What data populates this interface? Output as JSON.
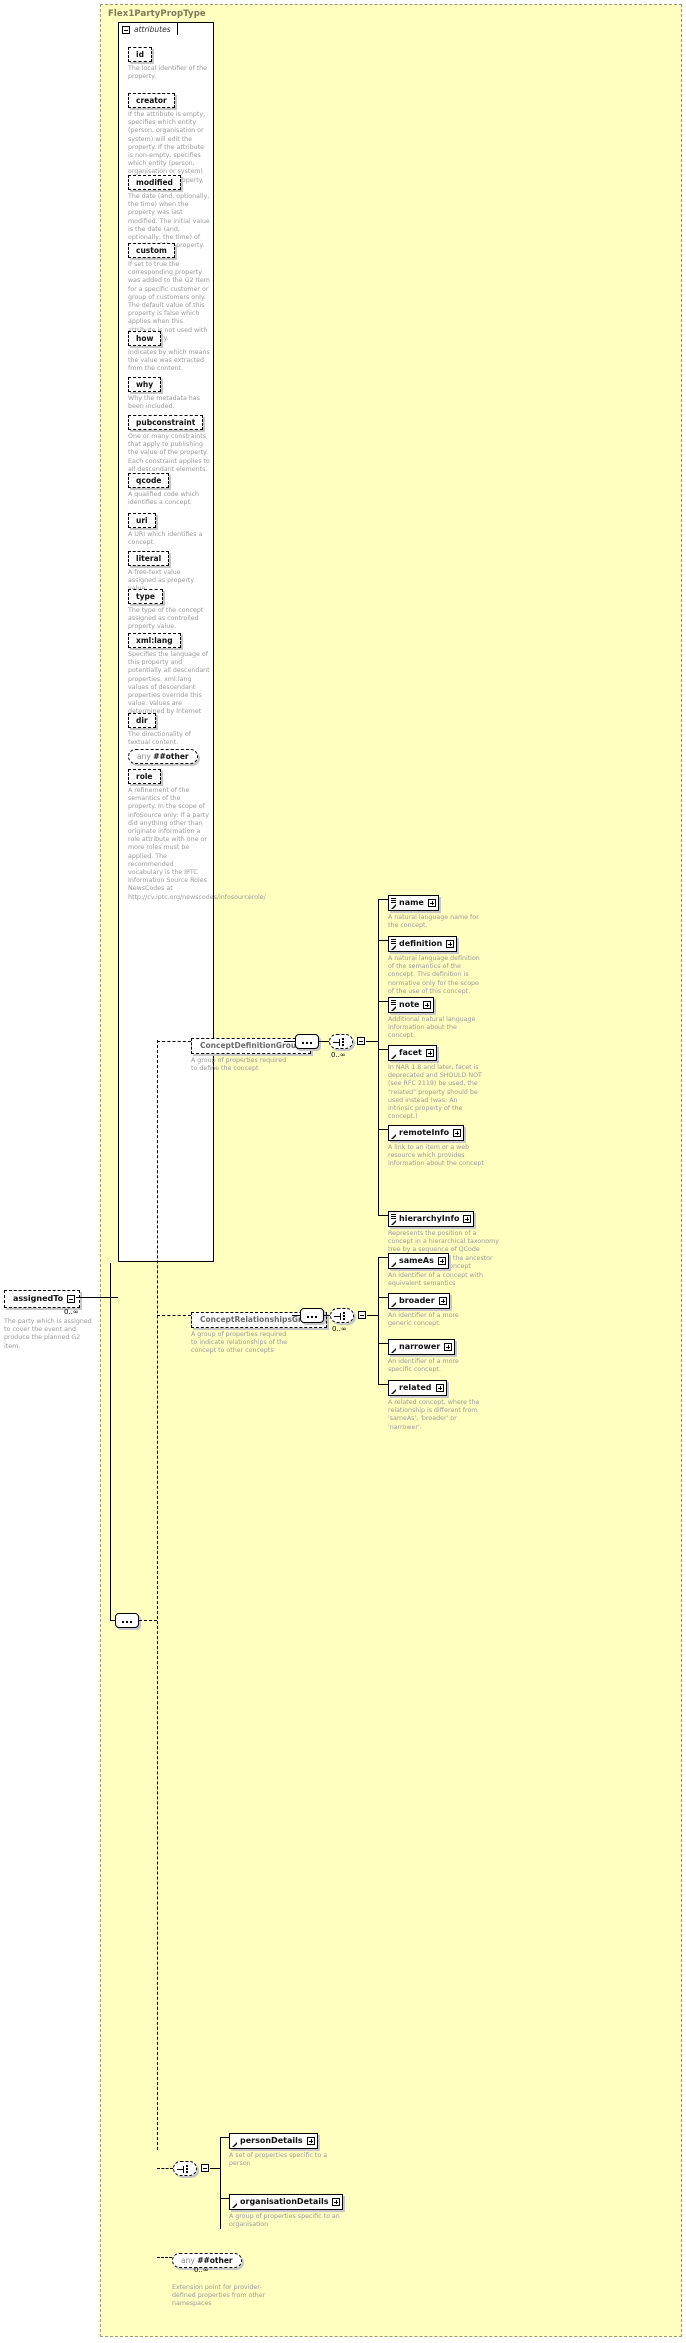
{
  "diagram": {
    "type_name": "Flex1PartyPropType",
    "attributes_label": "attributes"
  },
  "root_element": {
    "name": "assignedTo",
    "cardinality": "0..∞",
    "description": "The party which is assigned to cover the event and produce the planned G2 item."
  },
  "attributes": [
    {
      "name": "id",
      "description": "The local identifier of the property."
    },
    {
      "name": "creator",
      "description": "If the attribute is empty, specifies which entity (person, organisation or system) will edit the property. If the attribute is non-empty, specifies which entity (person, organisation or system) has edited the property."
    },
    {
      "name": "modified",
      "description": "The date (and, optionally, the time) when the property was last modified. The initial value is the date (and, optionally, the time) of creation of the property."
    },
    {
      "name": "custom",
      "description": "If set to true the corresponding property was added to the G2 Item for a specific customer or group of customers only. The default value of this property is false which applies when this attribute is not used with the property."
    },
    {
      "name": "how",
      "description": "Indicates by which means the value was extracted from the content."
    },
    {
      "name": "why",
      "description": "Why the metadata has been included."
    },
    {
      "name": "pubconstraint",
      "description": "One or many constraints that apply to publishing the value of the property. Each constraint applies to all descendant elements."
    },
    {
      "name": "qcode",
      "description": "A qualified code which identifies a concept."
    },
    {
      "name": "uri",
      "description": "A URI which identifies a concept."
    },
    {
      "name": "literal",
      "description": "A free-text value assigned as property value."
    },
    {
      "name": "type",
      "description": "The type of the concept assigned as controlled property value."
    },
    {
      "name": "xml:lang",
      "description": "Specifies the language of this property and potentially all descendant properties. xml:lang values of descendant properties override this value. Values are determined by Internet BCP 47."
    },
    {
      "name": "dir",
      "description": "The directionality of textual content."
    },
    {
      "name": "any ##other",
      "is_any": true,
      "any_prefix": "any",
      "any_ns": "##other",
      "description": ""
    },
    {
      "name": "role",
      "description": "A refinement of the semantics of the property. In the scope of infoSource only: If a party did anything other than originate information a role attribute with one or more roles must be applied. The recommended vocabulary is the IPTC Information Source Roles NewsCodes at http://cv.iptc.org/newscodes/infosourcerole/"
    }
  ],
  "groups": [
    {
      "id": "concept-definition-group",
      "name": "ConceptDefinitionGroup",
      "description": "A group of properties required to define the concept",
      "cardinality": "0..∞",
      "elements": [
        {
          "name": "name",
          "description": "A natural language name for the concept."
        },
        {
          "name": "definition",
          "description": "A natural language definition of the semantics of the concept. This definition is normative only for the scope of the use of this concept."
        },
        {
          "name": "note",
          "description": "Additional natural language information about the concept."
        },
        {
          "name": "facet",
          "description": "In NAR 1.8 and later, facet is deprecated and SHOULD NOT (see RFC 2119) be used, the \"related\" property should be used instead (was: An intrinsic property of the concept.)"
        },
        {
          "name": "remoteInfo",
          "description": "A link to an item or a web resource which provides information about the concept"
        },
        {
          "name": "hierarchyInfo",
          "description": "Represents the position of a concept in a hierarchical taxonomy tree by a sequence of QCode tokens representing the ancestor concepts and this concept"
        }
      ]
    },
    {
      "id": "concept-relationships-group",
      "name": "ConceptRelationshipsGroup",
      "description": "A group of properties required to indicate relationships of the concept to other concepts",
      "cardinality": "0..∞",
      "elements": [
        {
          "name": "sameAs",
          "description": "An identifier of a concept with equivalent semantics"
        },
        {
          "name": "broader",
          "description": "An identifier of a more generic concept."
        },
        {
          "name": "narrower",
          "description": "An identifier of a more specific concept."
        },
        {
          "name": "related",
          "description": "A related concept, where the relationship is different from 'sameAs', 'broader' or 'narrower'."
        }
      ]
    }
  ],
  "details_choice": {
    "elements": [
      {
        "name": "personDetails",
        "description": "A set of properties specific to a person"
      },
      {
        "name": "organisationDetails",
        "description": "A group of properties specific to an organisation"
      }
    ]
  },
  "extension": {
    "any_prefix": "any",
    "any_ns": "##other",
    "cardinality": "0..∞",
    "description": "Extension point for provider-defined properties from other namespaces"
  },
  "colors": {
    "type_background": "#ffffbf",
    "box_background": "#ffffff",
    "line": "#000000",
    "description_text": "#9a9a9a",
    "title_text": "#7a7a5a",
    "group_text": "#6a6a6a"
  }
}
